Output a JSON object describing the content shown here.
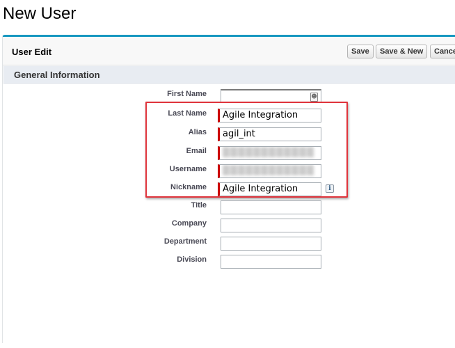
{
  "page": {
    "title": "New User"
  },
  "panel": {
    "title": "User Edit",
    "buttons": {
      "save": "Save",
      "save_new": "Save & New",
      "cancel": "Cance"
    }
  },
  "section": {
    "title": "General Information"
  },
  "fields": {
    "first_name": {
      "label": "First Name",
      "value": ""
    },
    "last_name": {
      "label": "Last Name",
      "value": "Agile Integration"
    },
    "alias": {
      "label": "Alias",
      "value": "agil_int"
    },
    "email": {
      "label": "Email",
      "value": ""
    },
    "username": {
      "label": "Username",
      "value": ""
    },
    "nickname": {
      "label": "Nickname",
      "value": "Agile Integration"
    },
    "title": {
      "label": "Title",
      "value": ""
    },
    "company": {
      "label": "Company",
      "value": ""
    },
    "department": {
      "label": "Department",
      "value": ""
    },
    "division": {
      "label": "Division",
      "value": ""
    }
  },
  "icons": {
    "lookup": "contact-card-icon",
    "info": "info-icon"
  },
  "colors": {
    "accent": "#1797c0",
    "required": "#cc0000",
    "highlight": "#e0343c",
    "section_bg": "#e8ecf2"
  }
}
